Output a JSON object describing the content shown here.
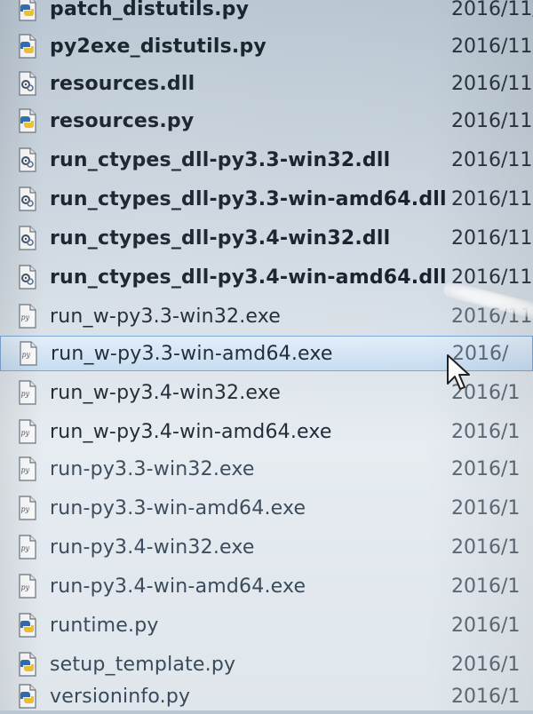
{
  "files": [
    {
      "name": "patch_distutils.py",
      "date": "2016/11/",
      "icon": "python-file-icon"
    },
    {
      "name": "py2exe_distutils.py",
      "date": "2016/11,",
      "icon": "python-file-icon"
    },
    {
      "name": "resources.dll",
      "date": "2016/11",
      "icon": "dll-file-icon"
    },
    {
      "name": "resources.py",
      "date": "2016/11",
      "icon": "python-file-icon"
    },
    {
      "name": "run_ctypes_dll-py3.3-win32.dll",
      "date": "2016/11",
      "icon": "dll-file-icon"
    },
    {
      "name": "run_ctypes_dll-py3.3-win-amd64.dll",
      "date": "2016/11",
      "icon": "dll-file-icon"
    },
    {
      "name": "run_ctypes_dll-py3.4-win32.dll",
      "date": "2016/11",
      "icon": "dll-file-icon"
    },
    {
      "name": "run_ctypes_dll-py3.4-win-amd64.dll",
      "date": "2016/11",
      "icon": "dll-file-icon"
    },
    {
      "name": "run_w-py3.3-win32.exe",
      "date": "2016/11",
      "icon": "exe-file-icon"
    },
    {
      "name": "run_w-py3.3-win-amd64.exe",
      "date": "2016/",
      "icon": "exe-file-icon",
      "selected": true
    },
    {
      "name": "run_w-py3.4-win32.exe",
      "date": "2016/1",
      "icon": "exe-file-icon"
    },
    {
      "name": "run_w-py3.4-win-amd64.exe",
      "date": "2016/1",
      "icon": "exe-file-icon"
    },
    {
      "name": "run-py3.3-win32.exe",
      "date": "2016/1",
      "icon": "exe-file-icon"
    },
    {
      "name": "run-py3.3-win-amd64.exe",
      "date": "2016/1",
      "icon": "exe-file-icon"
    },
    {
      "name": "run-py3.4-win32.exe",
      "date": "2016/1",
      "icon": "exe-file-icon"
    },
    {
      "name": "run-py3.4-win-amd64.exe",
      "date": "2016/1",
      "icon": "exe-file-icon"
    },
    {
      "name": "runtime.py",
      "date": "2016/1",
      "icon": "python-file-icon"
    },
    {
      "name": "setup_template.py",
      "date": "2016/1",
      "icon": "python-file-icon"
    },
    {
      "name": "versioninfo.py",
      "date": "2016/1",
      "icon": "python-file-icon"
    }
  ],
  "colors": {
    "selection_bg": "#c6dcf2",
    "selection_border": "#7aa7d6",
    "text": "#1d2833"
  }
}
